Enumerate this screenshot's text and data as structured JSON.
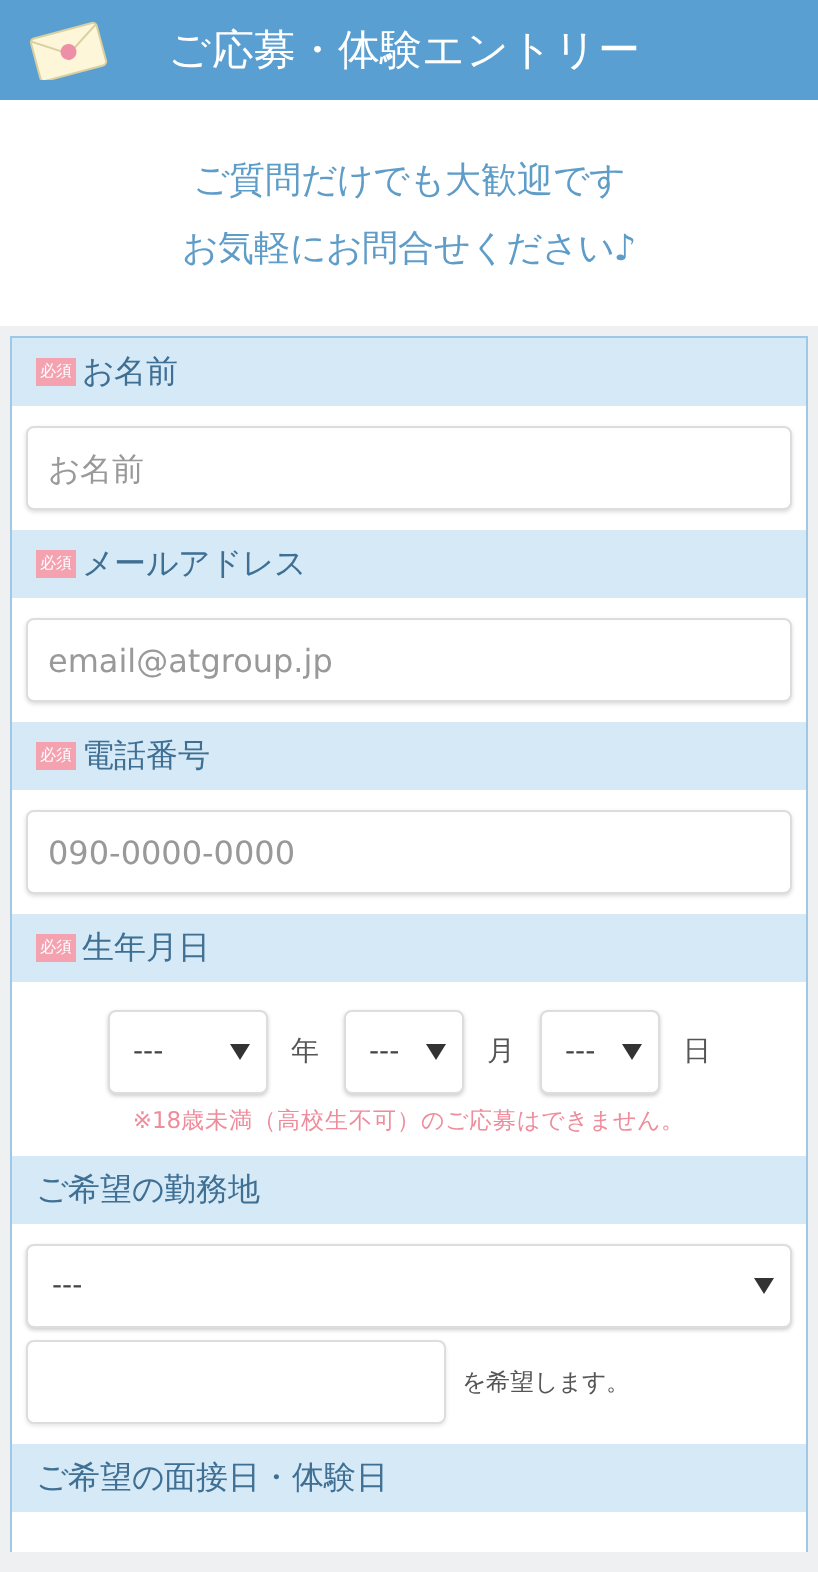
{
  "header": {
    "title": "ご応募・体験エントリー"
  },
  "intro": [
    "ご質問だけでも大歓迎です",
    "お気軽にお問合せください♪"
  ],
  "fields": [
    {
      "kind": "text",
      "label": "お名前",
      "required": true,
      "badge": "必須",
      "placeholder": "お名前"
    },
    {
      "kind": "text",
      "label": "メールアドレス",
      "required": true,
      "badge": "必須",
      "placeholder": "email@atgroup.jp"
    },
    {
      "kind": "text",
      "label": "電話番号",
      "required": true,
      "badge": "必須",
      "placeholder": "090-0000-0000"
    },
    {
      "kind": "date",
      "label": "生年月日",
      "required": true,
      "badge": "必須",
      "selects": [
        {
          "value": "---",
          "unit": "年"
        },
        {
          "value": "---",
          "unit": "月"
        },
        {
          "value": "---",
          "unit": "日"
        }
      ],
      "note": "※18歳未満（高校生不可）のご応募はできません。"
    },
    {
      "kind": "location",
      "label": "ご希望の勤務地",
      "required": false,
      "select": "---",
      "suffix": "を希望します。"
    },
    {
      "kind": "heading",
      "label": "ご希望の面接日・体験日",
      "required": false
    }
  ]
}
